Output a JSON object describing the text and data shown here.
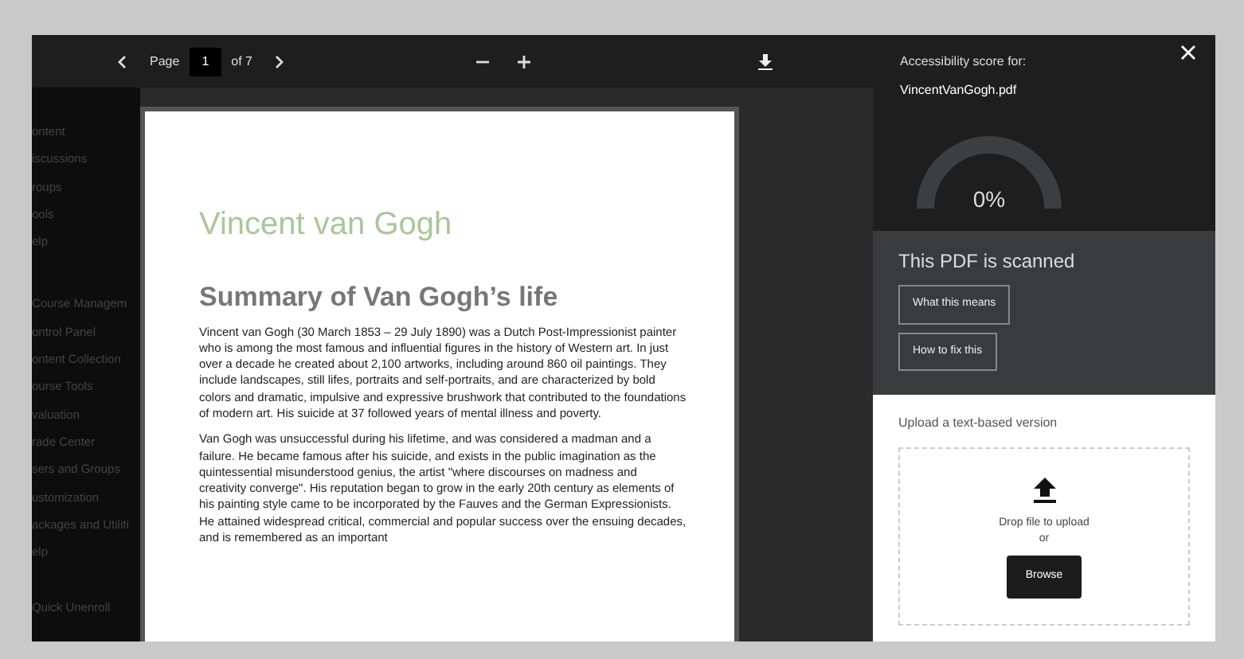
{
  "toolbar": {
    "page_label": "Page",
    "page_number": "1",
    "page_total": "of 7"
  },
  "sidebar": {
    "items": [
      {
        "label": "ontent"
      },
      {
        "label": "iscussions"
      },
      {
        "label": "roups"
      },
      {
        "label": "ools"
      },
      {
        "label": "elp"
      }
    ],
    "section_title": "Course Managem",
    "section_items": [
      {
        "label": "ontrol Panel"
      },
      {
        "label": "ontent Collection"
      },
      {
        "label": "ourse Tools"
      },
      {
        "label": "valuation"
      },
      {
        "label": "rade Center"
      },
      {
        "label": "sers and Groups"
      },
      {
        "label": "ustomization"
      },
      {
        "label": "ackages and Utiliti"
      },
      {
        "label": "elp"
      }
    ],
    "footer": "Quick Unenroll"
  },
  "document": {
    "title": "Vincent van Gogh",
    "heading": "Summary of Van Gogh’s life",
    "paragraphs": [
      "Vincent van Gogh (30 March 1853 – 29 July 1890) was a Dutch Post-Impressionist painter who is among the most famous and influential figures in the history of Western art. In just over a decade he created about 2,100 artworks, including around 860 oil paintings. They include landscapes, still lifes, portraits and self-portraits, and are characterized by bold colors and dramatic, impulsive and expressive brushwork that contributed to the foundations of modern art. His suicide at 37 followed years of mental illness and poverty.",
      "Van Gogh was unsuccessful during his lifetime, and was considered a madman and a failure. He became famous after his suicide, and exists in the public imagination as the quintessential misunderstood genius, the artist \"where discourses on madness and creativity converge\".  His reputation began to grow in the early 20th century as elements of his painting style came to be incorporated by the Fauves and the German Expressionists. He attained widespread critical, commercial and popular success over the ensuing decades, and is remembered as an important"
    ]
  },
  "panel": {
    "caption": "Accessibility score for:",
    "file_name": "VincentVanGogh.pdf",
    "score": {
      "reading": "0%"
    },
    "status": "This PDF is scanned",
    "buttons": [
      "What this means",
      "How to fix this"
    ],
    "upload": {
      "title": "Upload a text-based version",
      "drop_text": "Drop file to upload",
      "or_text": "or",
      "button": "Browse"
    }
  }
}
